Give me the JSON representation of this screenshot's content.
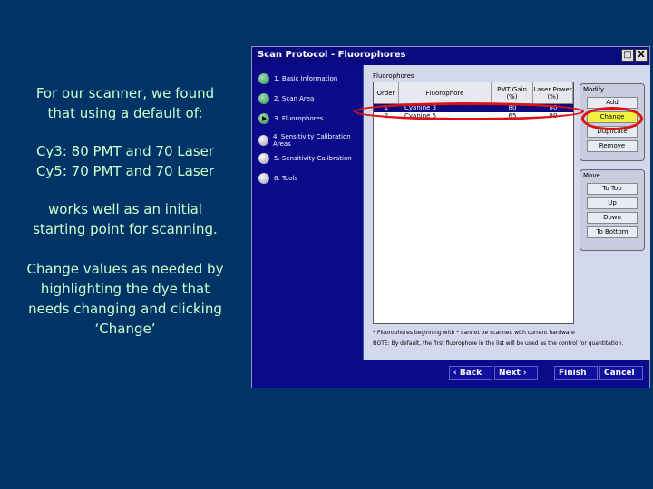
{
  "caption": {
    "intro_line1": "For our scanner, we found",
    "intro_line2": "that using a default of:",
    "cy3": "Cy3:  80 PMT and 70 Laser",
    "cy5": "Cy5:  70 PMT and 70 Laser",
    "works_line1": "works well as an initial",
    "works_line2": "starting point for scanning.",
    "change_line1": "Change values as needed by",
    "change_line2": "highlighting the dye that",
    "change_line3": "needs changing and clicking",
    "change_line4": "‘Change’"
  },
  "dialog": {
    "title": "Scan Protocol - Fluorophores",
    "steps": [
      {
        "label": "1. Basic Information",
        "state": "done"
      },
      {
        "label": "2. Scan Area",
        "state": "done"
      },
      {
        "label": "3. Fluorophores",
        "state": "current"
      },
      {
        "label": "4. Sensitivity Calibration Areas",
        "state": "pending"
      },
      {
        "label": "5. Sensitivity Calibration",
        "state": "pending"
      },
      {
        "label": "6. Tools",
        "state": "pending"
      }
    ],
    "group_label": "Fluorophores",
    "columns": [
      "Order",
      "Fluorophore",
      "PMT Gain (%)",
      "Laser Power (%)"
    ],
    "rows": [
      {
        "order": "1",
        "name": "Cyanine 3",
        "pmt": "80",
        "laser": "80",
        "selected": true
      },
      {
        "order": "2",
        "name": "Cyanine 5",
        "pmt": "65",
        "laser": "80",
        "selected": false
      }
    ],
    "note1": "* Fluorophores beginning with * cannot be scanned with current hardware",
    "note2": "NOTE: By default, the first fluorophore in the list will be used as the control for quantitation.",
    "modify": {
      "label": "Modify",
      "add": "Add",
      "change": "Change",
      "duplicate": "Duplicate",
      "remove": "Remove"
    },
    "move": {
      "label": "Move",
      "top": "To Top",
      "up": "Up",
      "down": "Down",
      "bottom": "To Bottom"
    },
    "nav": {
      "back": "‹ Back",
      "next": "Next ›",
      "finish": "Finish",
      "cancel": "Cancel"
    },
    "window_buttons": {
      "maximize": "□",
      "close": "X"
    }
  }
}
